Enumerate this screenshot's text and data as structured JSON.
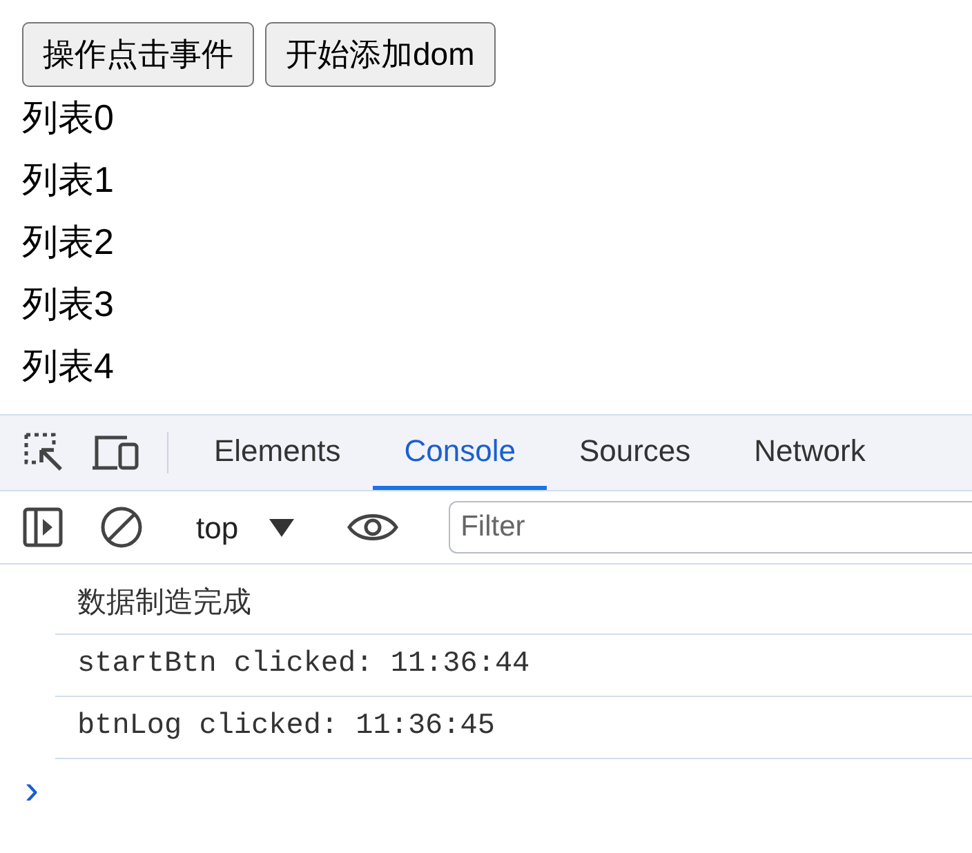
{
  "page": {
    "buttons": [
      "操作点击事件",
      "开始添加dom"
    ],
    "list_items": [
      "列表0",
      "列表1",
      "列表2",
      "列表3",
      "列表4"
    ]
  },
  "devtools": {
    "tabs": [
      {
        "label": "Elements",
        "selected": false
      },
      {
        "label": "Console",
        "selected": true
      },
      {
        "label": "Sources",
        "selected": false
      },
      {
        "label": "Network",
        "selected": false
      }
    ],
    "context": "top",
    "filter": {
      "placeholder": "Filter"
    },
    "messages": [
      {
        "text": "数据制造完成",
        "kind": "info"
      },
      {
        "text": "startBtn clicked: 11:36:44",
        "kind": "log"
      },
      {
        "text": "btnLog clicked: 11:36:45",
        "kind": "log"
      }
    ],
    "prompt": "›"
  }
}
